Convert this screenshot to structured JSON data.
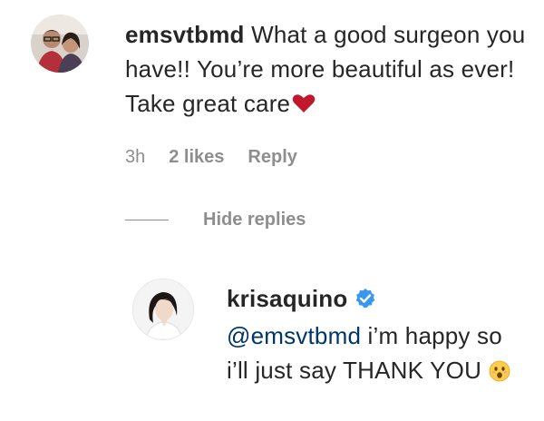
{
  "comment": {
    "username": "emsvtbmd",
    "text": "What a good surgeon you have!! You’re more beautiful as ever! Take great care",
    "heart_icon": "heart-icon",
    "time": "3h",
    "likes": "2 likes",
    "reply_label": "Reply"
  },
  "replies_toggle": {
    "label": "Hide replies"
  },
  "reply": {
    "username": "krisaquino",
    "verified_icon": "verified-badge-icon",
    "mention": "@emsvtbmd",
    "text": " i’m happy so i’ll just say THANK YOU",
    "emoji_icon": "astonished-face-emoji-icon"
  },
  "colors": {
    "text": "#262626",
    "meta": "#8e8e8e",
    "heart": "#c0182c",
    "verified": "#3897f0",
    "mention": "#003569"
  }
}
